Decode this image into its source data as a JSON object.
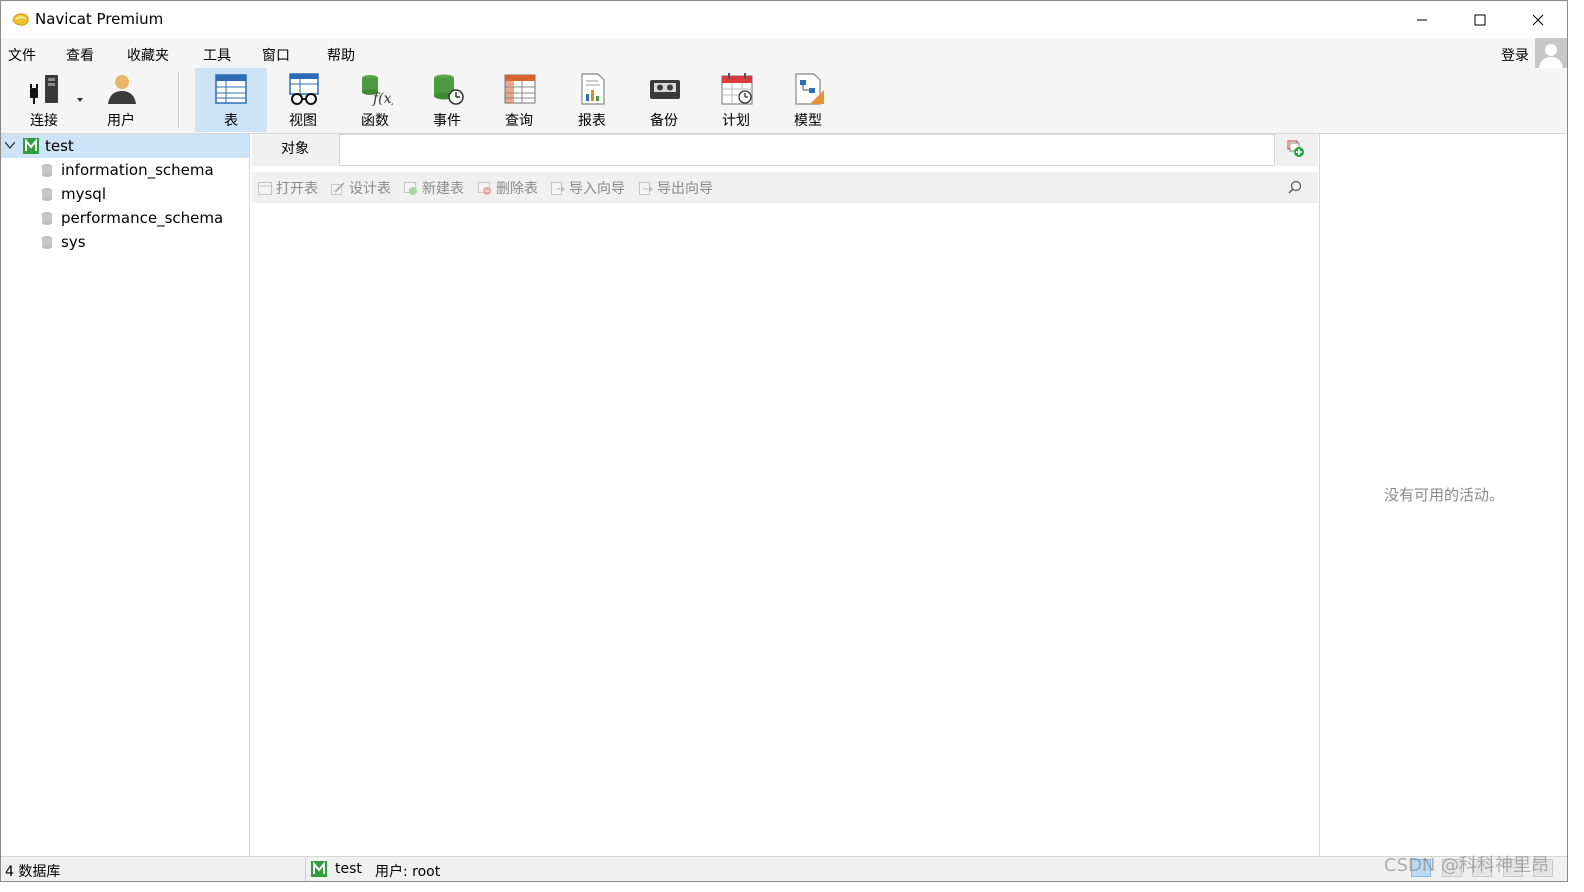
{
  "window": {
    "title": "Navicat Premium"
  },
  "menu": {
    "items": [
      "文件",
      "查看",
      "收藏夹",
      "工具",
      "窗口",
      "帮助"
    ],
    "login": "登录"
  },
  "toolbar": {
    "items": [
      {
        "label": "连接",
        "icon": "plug-icon"
      },
      {
        "label": "用户",
        "icon": "user-icon"
      },
      {
        "label": "表",
        "icon": "table-icon",
        "active": true
      },
      {
        "label": "视图",
        "icon": "view-glasses-icon"
      },
      {
        "label": "函数",
        "icon": "function-icon"
      },
      {
        "label": "事件",
        "icon": "event-clock-icon"
      },
      {
        "label": "查询",
        "icon": "query-grid-icon"
      },
      {
        "label": "报表",
        "icon": "report-icon"
      },
      {
        "label": "备份",
        "icon": "backup-tape-icon"
      },
      {
        "label": "计划",
        "icon": "calendar-icon"
      },
      {
        "label": "模型",
        "icon": "model-icon"
      }
    ]
  },
  "nav": {
    "connection": "test",
    "databases": [
      "information_schema",
      "mysql",
      "performance_schema",
      "sys"
    ]
  },
  "tabs": {
    "objects": "对象"
  },
  "object_toolbar": {
    "open": "打开表",
    "design": "设计表",
    "new": "新建表",
    "delete": "删除表",
    "import": "导入向导",
    "export": "导出向导"
  },
  "activity": {
    "empty": "没有可用的活动。"
  },
  "status": {
    "db_count": "4 数据库",
    "connection": "test",
    "user": "用户: root"
  },
  "watermark": "CSDN @科科神里昂",
  "colors": {
    "accent": "#cde3f7",
    "conn_green": "#2e9e3a",
    "disabled_text": "#8a8a8a"
  }
}
